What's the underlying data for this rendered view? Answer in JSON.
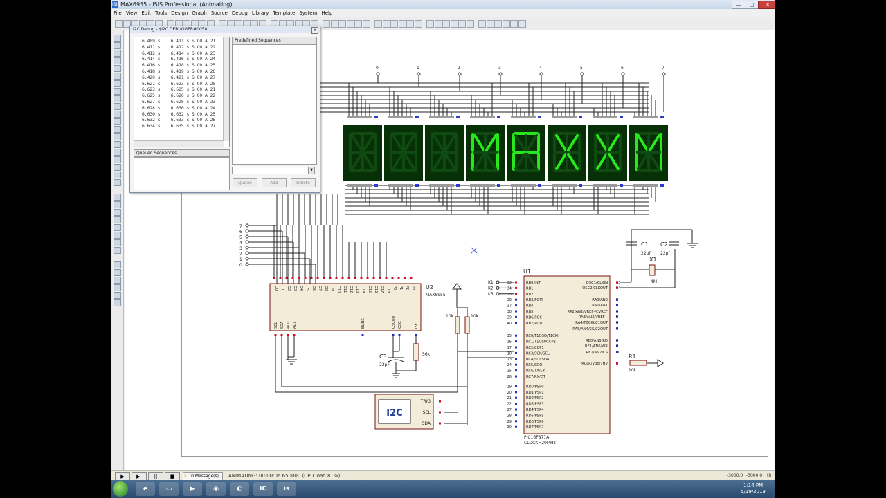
{
  "window": {
    "title": "MAX6955 - ISIS Professional (Animating)",
    "app_icon": "ISIS",
    "minimize": "—",
    "maximize": "□",
    "close": "✕"
  },
  "menu": [
    "File",
    "View",
    "Edit",
    "Tools",
    "Design",
    "Graph",
    "Source",
    "Debug",
    "Library",
    "Template",
    "System",
    "Help"
  ],
  "i2c_debug": {
    "title": "I2C Debug - $I2C DEBUGGER#0058",
    "close": "x",
    "log": [
      "6.409 s    6.411 s S C0 A 21",
      "6.411 s    6.412 s S C0 A 22",
      "6.412 s    6.414 s S C0 A 23",
      "6.414 s    6.416 s S C0 A 24",
      "6.416 s    6.418 s S C0 A 25",
      "6.418 s    6.419 s S C0 A 26",
      "6.420 s    6.421 s S C0 A 27",
      "6.621 s    6.623 s S C0 A 20",
      "6.623 s    6.625 s S C0 A 21",
      "6.625 s    6.626 s S C0 A 22",
      "6.627 s    6.628 s S C0 A 23",
      "6.628 s    6.630 s S C0 A 24",
      "6.630 s    6.632 s S C0 A 25",
      "6.632 s    6.633 s S C0 A 26",
      "6.634 s    6.635 s S C0 A 27"
    ],
    "predefined_label": "Predefined Sequences",
    "queued_label": "Queued Sequences",
    "queue_btn": "Queue",
    "add_btn": "Add",
    "delete_btn": "Delete"
  },
  "schematic": {
    "display_digits": [
      "0",
      "1",
      "2",
      "3",
      "4",
      "5",
      "6",
      "7"
    ],
    "display_chars": [
      "",
      "",
      "",
      "M",
      "A",
      "X",
      "X",
      "M"
    ],
    "dip_labels": [
      "7",
      "6",
      "5",
      "4",
      "3",
      "2",
      "1",
      "0"
    ],
    "max6955": {
      "ref": "U2",
      "part": "MAX6955",
      "pins_top": [
        "O0",
        "O1",
        "O2",
        "O3",
        "O4",
        "O5",
        "O6",
        "O7",
        "O8",
        "O9",
        "O10",
        "O11",
        "O12",
        "O13",
        "O14",
        "O15",
        "O16",
        "O17",
        "O18",
        "P0",
        "P1",
        "P2",
        "P3"
      ],
      "pins_bottom": [
        "SCL",
        "SDA",
        "AD0",
        "AD1",
        "BLINK",
        "OSCOUT",
        "OSC",
        "ISET"
      ]
    },
    "pic": {
      "ref": "U1",
      "part": "PIC16F877A",
      "clock": "CLOCK=20MHz",
      "left_pins": [
        "RB0/INT",
        "RB1",
        "RB2",
        "RB3/PGM",
        "RB4",
        "RB5",
        "RB6/PGC",
        "RB7/PGD",
        "RC0/T1OSO/T1CKI",
        "RC1/T1OSI/CCP2",
        "RC2/CCP1",
        "RC3/SCK/SCL",
        "RC4/SDI/SDA",
        "RC5/SDO",
        "RC6/TX/CK",
        "RC7/RX/DT",
        "RD0/PSP0",
        "RD1/PSP1",
        "RD2/PSP2",
        "RD3/PSP3",
        "RD4/PSP4",
        "RD5/PSP5",
        "RD6/PSP6",
        "RD7/PSP7"
      ],
      "left_nums": [
        "33",
        "34",
        "35",
        "36",
        "37",
        "38",
        "39",
        "40",
        "15",
        "16",
        "17",
        "18",
        "23",
        "24",
        "25",
        "26",
        "19",
        "20",
        "21",
        "22",
        "27",
        "28",
        "29",
        "30"
      ],
      "right_pins": [
        "OSC1/CLKIN",
        "OSC2/CLKOUT",
        "RA0/AN0",
        "RA1/AN1",
        "RA2/AN2/VREF-/CVREF",
        "RA3/AN3/VREF+",
        "RA4/T0CKI/C1OUT",
        "RA5/AN4/SS/C2OUT",
        "RE0/AN5/RD",
        "RE1/AN6/WR",
        "RE2/AN7/CS",
        "MCLR/Vpp/THV"
      ],
      "right_nums": [
        "13",
        "14",
        "2",
        "3",
        "4",
        "5",
        "6",
        "7",
        "8",
        "9",
        "10",
        "1"
      ]
    },
    "keys": [
      "K1",
      "K2",
      "K3"
    ],
    "c1": {
      "ref": "C1",
      "val": "22pf"
    },
    "c2": {
      "ref": "C2",
      "val": "22pf"
    },
    "x1": {
      "ref": "X1",
      "val": "4M"
    },
    "r1": {
      "ref": "R1",
      "val": "10k"
    },
    "c3": {
      "ref": "C3",
      "val": "22pF"
    },
    "r_iset": "56k",
    "pullups": [
      "10k",
      "10k"
    ],
    "i2c_block": {
      "label": "I2C",
      "pins": [
        "TRIG",
        "SCL",
        "SDA"
      ]
    }
  },
  "status": {
    "messages": "10 Message(s)",
    "animating": "ANIMATING: 00:00:06.650000 (CPU load 81%)",
    "coord_x": "-3000.0",
    "coord_y": "-3000.0",
    "unit": "th"
  },
  "taskbar": {
    "time": "1:14 PM",
    "date": "5/19/2013"
  },
  "colors": {
    "display_bg": "#073007",
    "segment_on": "#27e81b",
    "segment_off": "#0e4a12",
    "pin_red": "#c8101e",
    "pin_blue": "#1c2fc8",
    "component_fill": "#f3ecd9",
    "component_stroke": "#7a1010"
  }
}
